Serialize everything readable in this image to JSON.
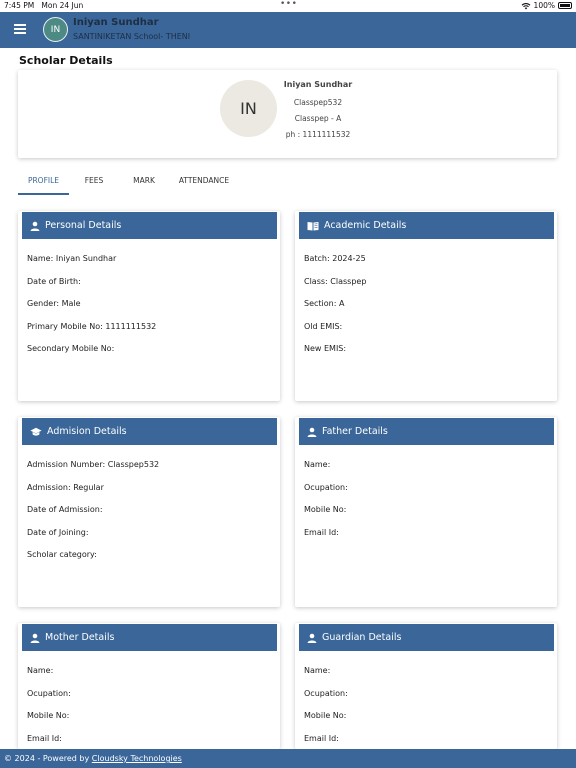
{
  "status_bar": {
    "time": "7:45 PM",
    "date": "Mon 24 Jun",
    "battery": "100%"
  },
  "app_bar": {
    "avatar_initials": "IN",
    "user_name": "Iniyan Sundhar",
    "school": "SANTINIKETAN School- THENI"
  },
  "page": {
    "title": "Scholar Details"
  },
  "profile": {
    "initials": "IN",
    "name": "Iniyan Sundhar",
    "class_code": "Classpep532",
    "class_section": "Classpep - A",
    "phone": "ph : 1111111532"
  },
  "tabs": [
    {
      "label": "PROFILE",
      "active": true
    },
    {
      "label": "FEES",
      "active": false
    },
    {
      "label": "MARK",
      "active": false
    },
    {
      "label": "ATTENDANCE",
      "active": false
    }
  ],
  "sections": {
    "personal": {
      "title": "Personal Details",
      "rows": [
        "Name: Iniyan Sundhar",
        "Date of Birth:",
        "Gender: Male",
        "Primary Mobile No: 1111111532",
        "Secondary Mobile No:"
      ]
    },
    "academic": {
      "title": "Academic Details",
      "rows": [
        "Batch: 2024-25",
        "Class: Classpep",
        "Section: A",
        "Old EMIS:",
        "New EMIS:"
      ]
    },
    "admission": {
      "title": "Admision Details",
      "rows": [
        "Admission Number: Classpep532",
        "Admission: Regular",
        "Date of Admission:",
        "Date of Joining:",
        "Scholar category:"
      ]
    },
    "father": {
      "title": "Father Details",
      "rows": [
        "Name:",
        "Ocupation:",
        "Mobile No:",
        "Email Id:"
      ]
    },
    "mother": {
      "title": "Mother Details",
      "rows": [
        "Name:",
        "Ocupation:",
        "Mobile No:",
        "Email Id:"
      ]
    },
    "guardian": {
      "title": "Guardian Details",
      "rows": [
        "Name:",
        "Ocupation:",
        "Mobile No:",
        "Email Id:"
      ]
    }
  },
  "footer": {
    "prefix": "© 2024 - Powered by ",
    "link": "Cloudsky Technologies"
  },
  "colors": {
    "primary": "#3a6699",
    "avatar_bar": "#4e8a84",
    "avatar_profile": "#ece9e2"
  },
  "icons": {
    "menu": "hamburger-menu-icon",
    "personal": "person-icon",
    "academic": "book-icon",
    "admission": "graduation-cap-icon",
    "father": "person-icon",
    "mother": "person-icon",
    "guardian": "person-icon"
  }
}
